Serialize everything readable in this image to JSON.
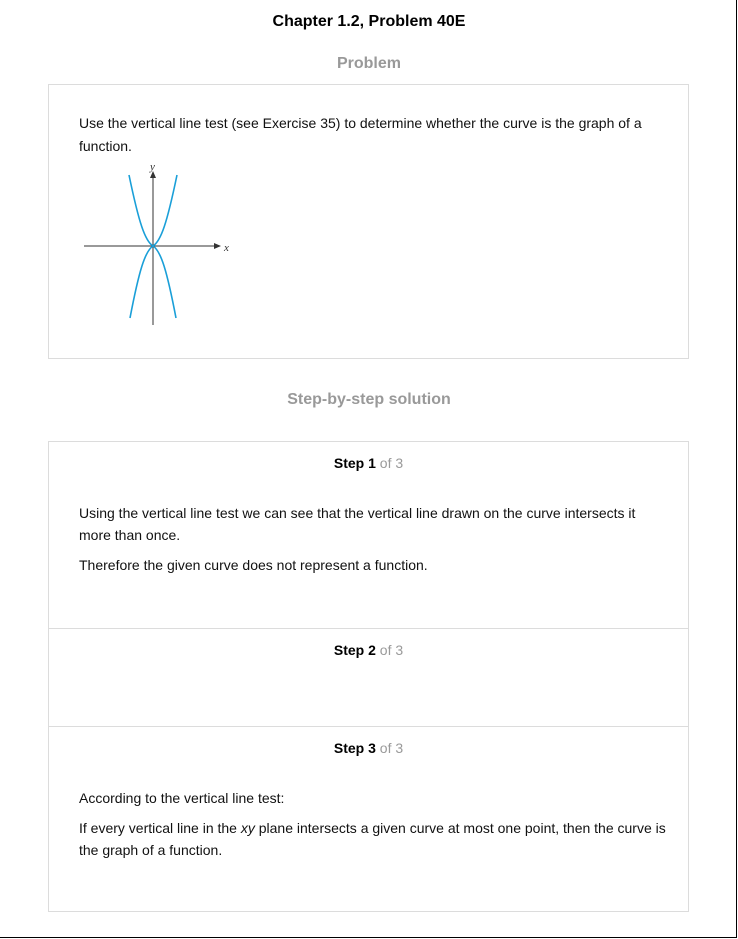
{
  "header": {
    "chapter_title": "Chapter 1.2, Problem 40E"
  },
  "problem": {
    "heading": "Problem",
    "text": "Use the vertical line test (see Exercise 35) to determine whether the curve is the graph of a function.",
    "graph": {
      "x_axis_label": "x",
      "y_axis_label": "y",
      "curve_color": "#1a9fd8"
    }
  },
  "solution": {
    "heading": "Step-by-step solution",
    "of_label": "of 3",
    "steps": [
      {
        "word": "Step",
        "number": "1",
        "paragraphs": [
          "Using the vertical line test we can see that the vertical line drawn on the curve intersects it more than once.",
          "Therefore the given curve does not represent a function."
        ]
      },
      {
        "word": "Step",
        "number": "2",
        "paragraphs": []
      },
      {
        "word": "Step",
        "number": "3",
        "paragraphs": [
          "According to the vertical line test:"
        ],
        "rule_before": "If every vertical line in the ",
        "rule_italic": "xy",
        "rule_after": " plane intersects a given curve at most one point, then the curve is the graph of a function."
      }
    ]
  }
}
